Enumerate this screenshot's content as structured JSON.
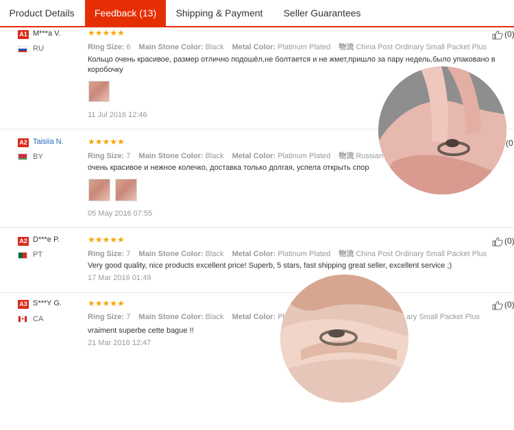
{
  "tabs": [
    {
      "label": "Product Details"
    },
    {
      "label": "Feedback (13)"
    },
    {
      "label": "Shipping & Payment"
    },
    {
      "label": "Seller Guarantees"
    }
  ],
  "attr_labels": {
    "ring_size": "Ring Size:",
    "stone_color": "Main Stone Color:",
    "metal_color": "Metal Color:",
    "shipping": "物流"
  },
  "reviews": [
    {
      "badge": "A1",
      "name": "M***a V.",
      "country": "RU",
      "stars": "★★★★★",
      "ring_size": "6",
      "stone_color": "Black",
      "metal_color": "Platinum Plated",
      "shipping": "China Post Ordinary Small Packet Plus",
      "text": "Кольцо очень красивое, размер отлично подошёл,не болтается и не жмет,пришло за пару недель,было упаковано в коробочку",
      "date": "11 Jul 2016 12:46",
      "likes": "(0)"
    },
    {
      "badge": "A2",
      "name": "Taisiia N.",
      "country": "BY",
      "stars": "★★★★★",
      "ring_size": "7",
      "stone_color": "Black",
      "metal_color": "Platinum Plated",
      "shipping": "Russian A",
      "text": "очень красивое и нежное колечко, доставка только долгая, успела открыть спор",
      "date": "05 May 2016 07:55",
      "likes": "(0"
    },
    {
      "badge": "A2",
      "name": "D***e P.",
      "country": "PT",
      "stars": "★★★★★",
      "ring_size": "7",
      "stone_color": "Black",
      "metal_color": "Platinum Plated",
      "shipping": "China Post Ordinary Small Packet Plus",
      "text": "Very good quality, nice products excellent price! Superb, 5 stars, fast shipping great seller, excellent service ;)",
      "date": "17 Mar 2016 01:49",
      "likes": "(0)"
    },
    {
      "badge": "A3",
      "name": "S***Y G.",
      "country": "CA",
      "stars": "★★★★★",
      "ring_size": "7",
      "stone_color": "Black",
      "metal_color": "Pla",
      "shipping": "ary Small Packet Plus",
      "text": "vraiment superbe cette bague !!",
      "date": "21 Mar 2016 12:47",
      "likes": "(0)"
    }
  ],
  "colors": {
    "accent": "#e62e04",
    "badge": "#d92b1c",
    "stars": "#f7a500",
    "link": "#1b66b3"
  },
  "icons": [
    "thumbs-up-icon",
    "flag-icon"
  ]
}
